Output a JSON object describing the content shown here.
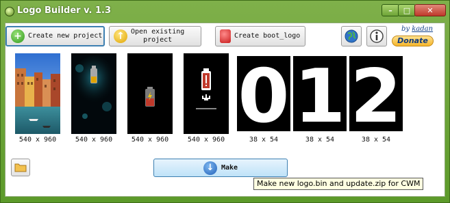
{
  "window": {
    "title": "Logo Builder v. 1.3"
  },
  "toolbar": {
    "create_new": "Create new project",
    "open_existing_line1": "Open existing",
    "open_existing_line2": "project",
    "create_boot": "Create boot_logo"
  },
  "author": {
    "prefix": "by",
    "name": "kadan"
  },
  "donate": {
    "label": "Donate"
  },
  "images": [
    {
      "caption": "540 x 960",
      "kind": "photo-city"
    },
    {
      "caption": "540 x 960",
      "kind": "battery-bokeh"
    },
    {
      "caption": "540 x 960",
      "kind": "battery-charging"
    },
    {
      "caption": "540 x 960",
      "kind": "battery-warning"
    },
    {
      "caption": "38 x 54",
      "digit": "0"
    },
    {
      "caption": "38 x 54",
      "digit": "1"
    },
    {
      "caption": "38 x 54",
      "digit": "2"
    }
  ],
  "make": {
    "label": "Make",
    "tooltip": "Make new logo.bin and update.zip for CWM"
  },
  "colors": {
    "title_bar": "#5c9a2a",
    "accent_blue": "#3c7fb1",
    "donate": "#f5b52b"
  }
}
